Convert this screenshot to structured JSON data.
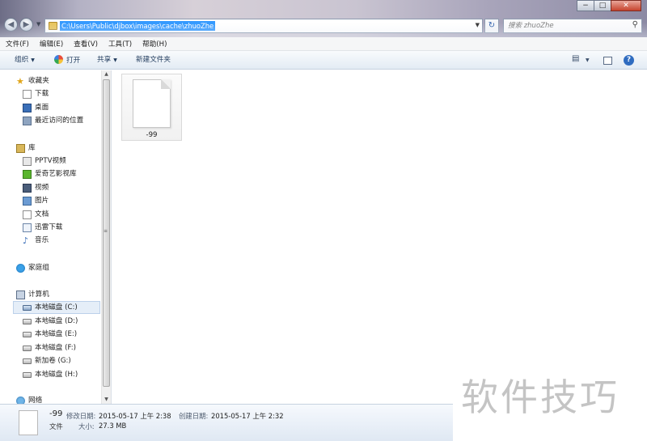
{
  "window": {
    "address_path": "C:\\Users\\Public\\djbox\\images\\cache\\zhuoZhe",
    "search_placeholder": "搜索 zhuoZhe",
    "minimize": "−",
    "maximize": "□",
    "close": "✕",
    "back": "◀",
    "forward": "▶",
    "refresh": "↻"
  },
  "menubar": [
    "文件(F)",
    "编辑(E)",
    "查看(V)",
    "工具(T)",
    "帮助(H)"
  ],
  "toolbar": {
    "organize": "组织",
    "open": "打开",
    "share": "共享",
    "new_folder": "新建文件夹",
    "help": "?"
  },
  "sidebar": {
    "favorites": {
      "label": "收藏夹",
      "items": [
        "下载",
        "桌面",
        "最近访问的位置"
      ]
    },
    "libraries": {
      "label": "库",
      "items": [
        "PPTV视频",
        "爱奇艺影视库",
        "视频",
        "图片",
        "文档",
        "迅雷下载",
        "音乐"
      ]
    },
    "homegroup": "家庭组",
    "computer": {
      "label": "计算机",
      "items": [
        "本地磁盘 (C:)",
        "本地磁盘 (D:)",
        "本地磁盘 (E:)",
        "本地磁盘 (F:)",
        "新加卷 (G:)",
        "本地磁盘 (H:)"
      ]
    },
    "network": "网络"
  },
  "files": [
    {
      "name": "-99"
    }
  ],
  "details": {
    "name": "-99",
    "type": "文件",
    "modified_label": "修改日期:",
    "modified_value": "2015-05-17 上午 2:38",
    "created_label": "创建日期:",
    "created_value": "2015-05-17 上午 2:32",
    "size_label": "大小:",
    "size_value": "27.3 MB"
  },
  "watermark": "软件技巧"
}
